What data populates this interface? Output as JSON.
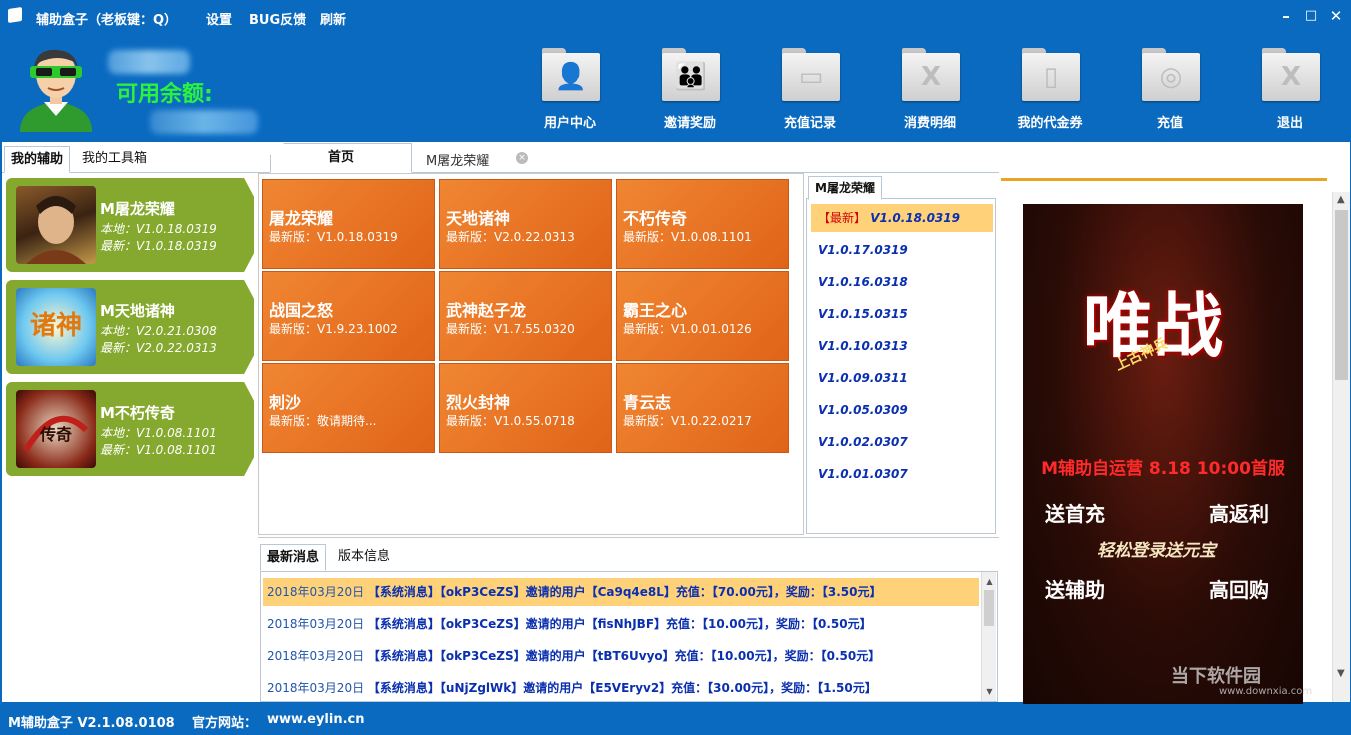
{
  "titlebar": {
    "title": "辅助盒子（老板键：Q）",
    "menu": [
      "设置",
      "BUG反馈",
      "刷新"
    ],
    "min": "–",
    "max": "□",
    "close": "✕"
  },
  "header": {
    "balance_label": "可用余额:",
    "tools": [
      {
        "label": "用户中心",
        "glyph": "👤"
      },
      {
        "label": "邀请奖励",
        "glyph": "👪"
      },
      {
        "label": "充值记录",
        "glyph": "▭"
      },
      {
        "label": "消费明细",
        "glyph": "X"
      },
      {
        "label": "我的代金券",
        "glyph": "▯"
      },
      {
        "label": "充值",
        "glyph": "◎"
      },
      {
        "label": "退出",
        "glyph": "X"
      }
    ]
  },
  "left": {
    "tabs": [
      "我的辅助",
      "我的工具箱"
    ],
    "cards": [
      {
        "name": "M屠龙荣耀",
        "local": "本地：V1.0.18.0319",
        "latest": "最新：V1.0.18.0319"
      },
      {
        "name": "M天地诸神",
        "local": "本地：V2.0.21.0308",
        "latest": "最新：V2.0.22.0313"
      },
      {
        "name": "M不朽传奇",
        "local": "本地：V1.0.08.1101",
        "latest": "最新：V1.0.08.1101"
      }
    ]
  },
  "middle": {
    "tabs": {
      "home": "首页",
      "second": "M屠龙荣耀",
      "close": "×"
    },
    "tiles": [
      {
        "name": "屠龙荣耀",
        "ver": "最新版：V1.0.18.0319"
      },
      {
        "name": "天地诸神",
        "ver": "最新版：V2.0.22.0313"
      },
      {
        "name": "不朽传奇",
        "ver": "最新版：V1.0.08.1101"
      },
      {
        "name": "战国之怒",
        "ver": "最新版：V1.9.23.1002"
      },
      {
        "name": "武神赵子龙",
        "ver": "最新版：V1.7.55.0320"
      },
      {
        "name": "霸王之心",
        "ver": "最新版：V1.0.01.0126"
      },
      {
        "name": "刺沙",
        "ver": "最新版：敬请期待..."
      },
      {
        "name": "烈火封神",
        "ver": "最新版：V1.0.55.0718"
      },
      {
        "name": "青云志",
        "ver": "最新版：V1.0.22.0217"
      }
    ],
    "versions": {
      "tab": "M屠龙荣耀",
      "new_tag": "【最新】",
      "items": [
        "V1.0.18.0319",
        "V1.0.17.0319",
        "V1.0.16.0318",
        "V1.0.15.0315",
        "V1.0.10.0313",
        "V1.0.09.0311",
        "V1.0.05.0309",
        "V1.0.02.0307",
        "V1.0.01.0307"
      ]
    },
    "news": {
      "tabs": [
        "最新消息",
        "版本信息"
      ],
      "rows": [
        {
          "date": "2018年03月20日",
          "text": "【系统消息】【okP3CeZS】邀请的用户【Ca9q4e8L】充值：【70.00元】，奖励：【3.50元】"
        },
        {
          "date": "2018年03月20日",
          "text": "【系统消息】【okP3CeZS】邀请的用户【fisNhJBF】充值：【10.00元】，奖励：【0.50元】"
        },
        {
          "date": "2018年03月20日",
          "text": "【系统消息】【okP3CeZS】邀请的用户【tBT6Uvyo】充值：【10.00元】，奖励：【0.50元】"
        },
        {
          "date": "2018年03月20日",
          "text": "【系统消息】【uNjZglWk】邀请的用户【E5VEryv2】充值：【30.00元】，奖励：【1.50元】"
        }
      ]
    }
  },
  "ad": {
    "logo_main": "唯战",
    "logo_sub": "上古神兵",
    "headline": "M辅助自运营    8.18  10:00首服",
    "lines": [
      "送首充",
      "高返利",
      "轻松登录送元宝",
      "送辅助",
      "高回购"
    ]
  },
  "watermark": {
    "main": "当下软件园",
    "sub": "www.downxia.com"
  },
  "status": {
    "version": "M辅助盒子 V2.1.08.0108",
    "site_label": "官方网站：",
    "site": "www.eylin.cn"
  }
}
